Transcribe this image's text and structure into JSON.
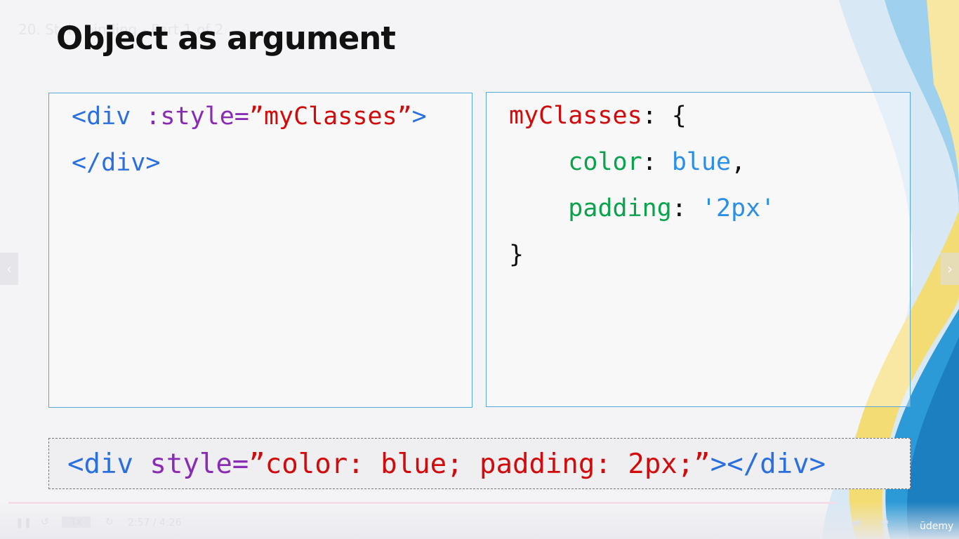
{
  "lecture_overlay": "20. Style binding - Part 1 of 2",
  "slide": {
    "title": "Object as argument"
  },
  "left_panel": {
    "line1": {
      "open": "<div ",
      "attr": ":style=",
      "value": "”myClasses”",
      "close": ">"
    },
    "line2": "</div>"
  },
  "right_panel": {
    "line1": {
      "name": "myClasses",
      "punc": ": {"
    },
    "line2": {
      "prop": "color",
      "colon": ": ",
      "value": "blue",
      "comma": ","
    },
    "line3": {
      "prop": "padding",
      "colon": ": ",
      "value": "'2px'"
    },
    "line4": "}"
  },
  "result": {
    "open": "<div ",
    "attr": "style=",
    "value": "”color: blue; padding: 2px;”",
    "close": "></div>"
  },
  "player": {
    "play_icon": "pause-icon",
    "rewind_icon": "rewind-icon",
    "speed": "1x",
    "forward_icon": "forward-icon",
    "time": "2:57 / 4:26",
    "brand": "ūdemy"
  },
  "colors": {
    "tag": "#2a6fe0",
    "attr": "#8a2bb5",
    "string": "#d10a0a",
    "property": "#0aa34c",
    "value": "#2a8fe6",
    "panel_border": "#55a8d8"
  }
}
